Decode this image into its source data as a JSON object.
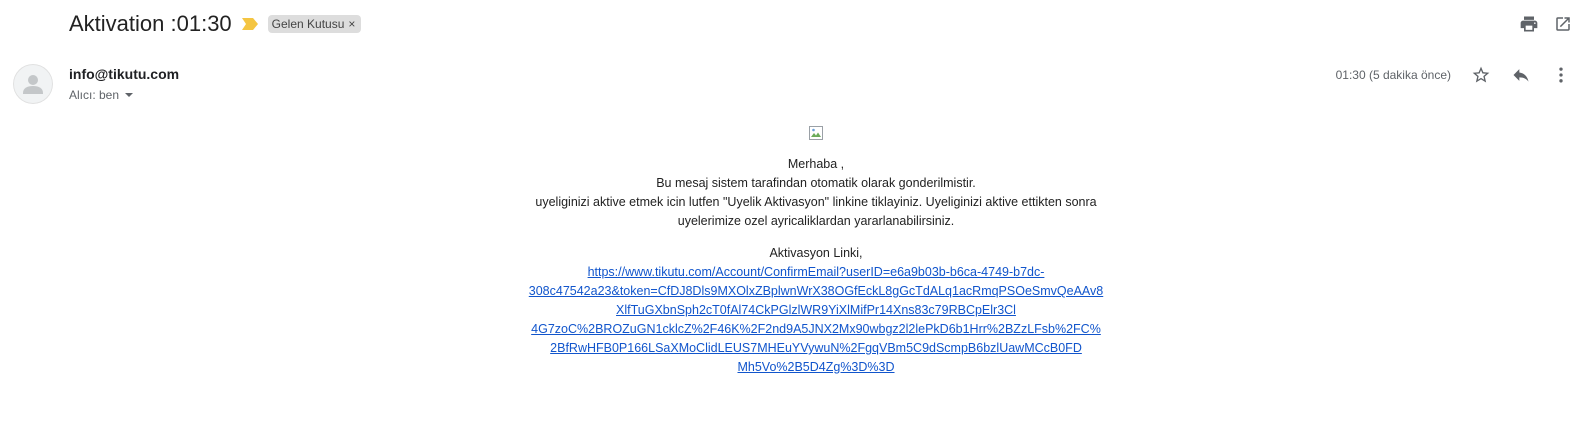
{
  "email": {
    "subject": "Aktivation :01:30",
    "label": "Gelen Kutusu",
    "label_remove": "×",
    "importance_icon": "importance-marker-icon",
    "sender": "info@tikutu.com",
    "recipient": "Alıcı: ben",
    "time": "01:30 (5 dakika önce)",
    "actions": {
      "print_icon": "print-icon",
      "new_window_icon": "open-in-new-window-icon",
      "star_icon": "star-icon",
      "reply_icon": "reply-icon",
      "more_icon": "more-vertical-icon"
    }
  },
  "message": {
    "greeting": "Merhaba ,",
    "line1": "Bu mesaj sistem tarafindan otomatik olarak gonderilmistir.",
    "line2": "uyeliginizi aktive etmek icin lutfen \"Uyelik Aktivasyon\" linkine tiklayiniz. Uyeliginizi aktive ettikten sonra uyelerimize ozel ayricaliklardan yararlanabilirsiniz.",
    "link_heading": "Aktivasyon Linki,",
    "link_lines": [
      "https://www.tikutu.com/Account/ConfirmEmail?userID=e6a9b03b-b6ca-4749-b7dc-",
      "308c47542a23&token=CfDJ8Dls9MXOlxZBplwnWrX38OGfEckL8gGcTdALq1acRmqPSOeSmvQeAAv8",
      "XlfTuGXbnSph2cT0fAl74CkPGlzlWR9YiXlMifPr14Xns83c79RBCpElr3Cl",
      "4G7zoC%2BROZuGN1cklcZ%2F46K%2F2nd9A5JNX2Mx90wbgz2l2lePkD6b1Hrr%2BZzLFsb%2FC%",
      "2BfRwHFB0P166LSaXMoClidLEUS7MHEuYVywuN%2FgqVBm5C9dScmpB6bzlUawMCcB0FD",
      "Mh5Vo%2B5D4Zg%3D%3D"
    ],
    "colors": {
      "link": "#1155cc",
      "label_chip_bg": "#dddddd",
      "importance": "#f4c542"
    }
  }
}
